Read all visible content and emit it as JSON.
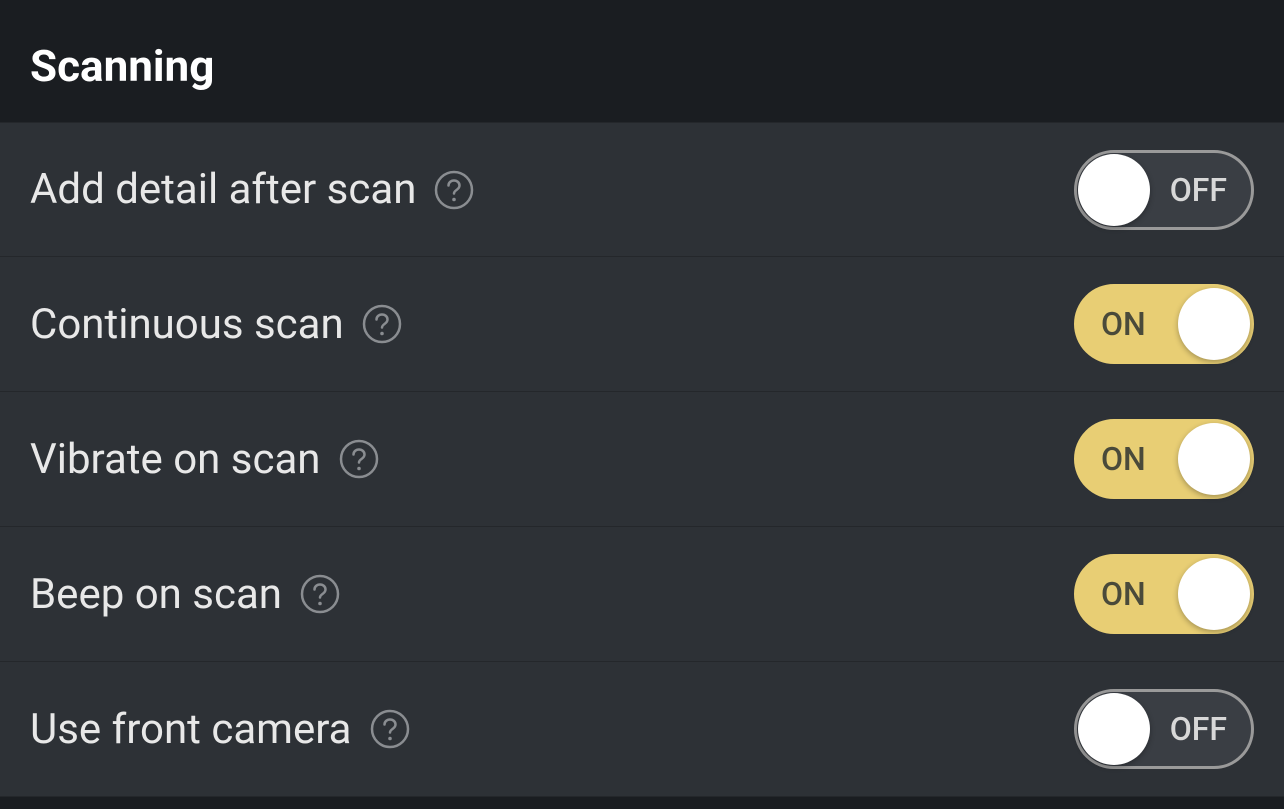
{
  "section": {
    "title": "Scanning"
  },
  "toggle_labels": {
    "on": "ON",
    "off": "OFF"
  },
  "settings": {
    "add_detail": {
      "label": "Add detail after scan",
      "state": "off"
    },
    "continuous_scan": {
      "label": "Continuous scan",
      "state": "on"
    },
    "vibrate_on_scan": {
      "label": "Vibrate on scan",
      "state": "on"
    },
    "beep_on_scan": {
      "label": "Beep on scan",
      "state": "on"
    },
    "use_front_camera": {
      "label": "Use front camera",
      "state": "off"
    }
  },
  "colors": {
    "toggle_on_bg": "#e8ce74",
    "toggle_off_bg": "#3a3e44",
    "page_bg": "#1a1d21",
    "row_bg": "#2d3136"
  }
}
